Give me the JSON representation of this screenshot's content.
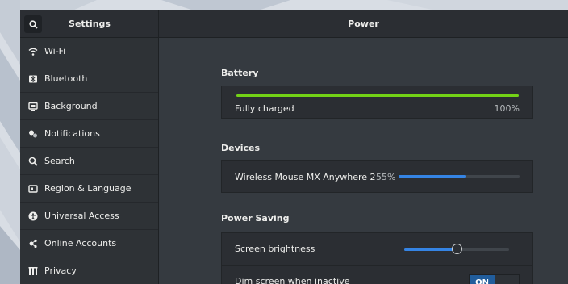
{
  "header": {
    "sidebar_title": "Settings",
    "panel_title": "Power"
  },
  "sidebar": {
    "items": [
      {
        "label": "Wi-Fi",
        "icon": "wifi-icon"
      },
      {
        "label": "Bluetooth",
        "icon": "bluetooth-icon"
      },
      {
        "label": "Background",
        "icon": "background-icon"
      },
      {
        "label": "Notifications",
        "icon": "notifications-icon"
      },
      {
        "label": "Search",
        "icon": "search-icon"
      },
      {
        "label": "Region & Language",
        "icon": "region-icon"
      },
      {
        "label": "Universal Access",
        "icon": "universal-access-icon"
      },
      {
        "label": "Online Accounts",
        "icon": "online-accounts-icon"
      },
      {
        "label": "Privacy",
        "icon": "privacy-icon"
      }
    ]
  },
  "battery": {
    "section_title": "Battery",
    "status": "Fully charged",
    "percent": "100%",
    "level": 1.0,
    "color": "#73d216"
  },
  "devices": {
    "section_title": "Devices",
    "items": [
      {
        "name": "Wireless Mouse MX Anywhere 2",
        "percent": "55%",
        "level": 0.55
      }
    ],
    "color": "#3584e4"
  },
  "power_saving": {
    "section_title": "Power Saving",
    "brightness_label": "Screen brightness",
    "brightness_level": 0.5,
    "dim_label": "Dim screen when inactive",
    "dim_toggle": "ON"
  },
  "colors": {
    "accent": "#215d9c",
    "window_bg": "#353a40",
    "card_bg": "#2b2e33"
  }
}
